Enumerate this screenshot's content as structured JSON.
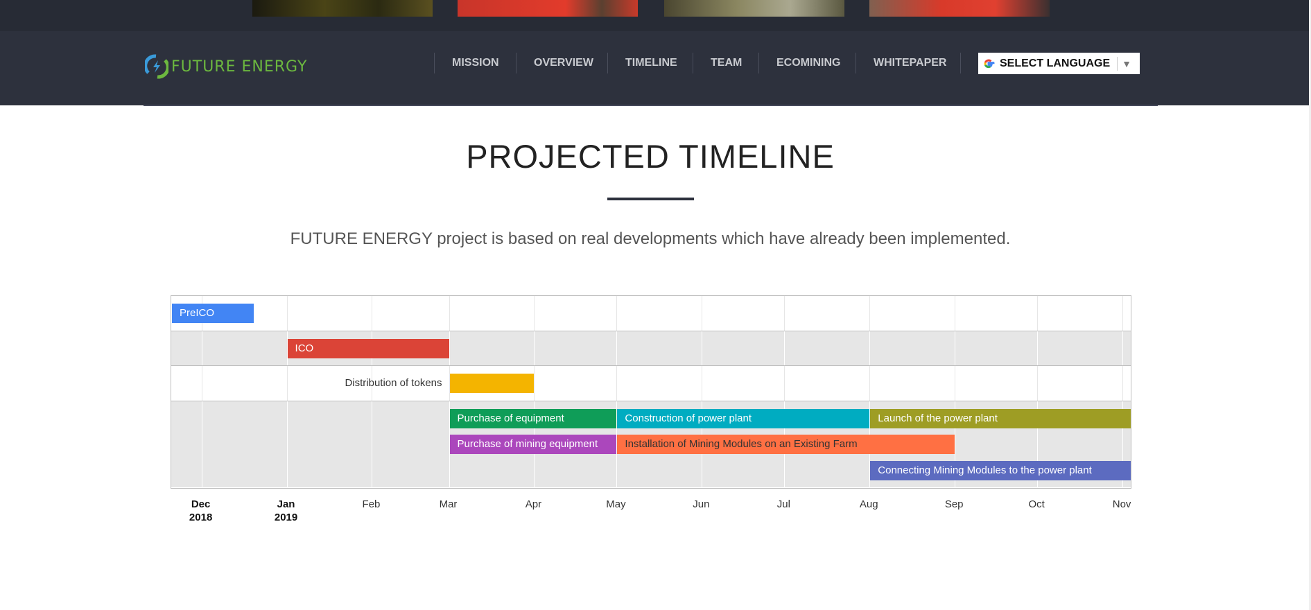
{
  "nav": {
    "logo_text": "FUTURE ENERGY",
    "items": [
      "MISSION",
      "OVERVIEW",
      "TIMELINE",
      "TEAM",
      "ECOMINING",
      "WHITEPAPER"
    ],
    "language_label": "SELECT LANGUAGE"
  },
  "main": {
    "title": "PROJECTED TIMELINE",
    "subtitle": "FUTURE ENERGY project is based on real developments which have already been implemented."
  },
  "chart_data": {
    "type": "timeline",
    "range": [
      "2018-11-20",
      "2019-11-04"
    ],
    "ticks": [
      {
        "date": "2018-12-01",
        "label": "Dec",
        "sub": "2018",
        "bold": true
      },
      {
        "date": "2019-01-01",
        "label": "Jan",
        "sub": "2019",
        "bold": true
      },
      {
        "date": "2019-02-01",
        "label": "Feb"
      },
      {
        "date": "2019-03-01",
        "label": "Mar"
      },
      {
        "date": "2019-04-01",
        "label": "Apr"
      },
      {
        "date": "2019-05-01",
        "label": "May"
      },
      {
        "date": "2019-06-01",
        "label": "Jun"
      },
      {
        "date": "2019-07-01",
        "label": "Jul"
      },
      {
        "date": "2019-08-01",
        "label": "Aug"
      },
      {
        "date": "2019-09-01",
        "label": "Sep"
      },
      {
        "date": "2019-10-01",
        "label": "Oct"
      },
      {
        "date": "2019-11-01",
        "label": "Nov"
      }
    ],
    "rows": [
      {
        "lanes": 1,
        "shaded": false
      },
      {
        "lanes": 1,
        "shaded": true
      },
      {
        "lanes": 1,
        "shaded": false
      },
      {
        "lanes": 3,
        "shaded": true
      }
    ],
    "bars": [
      {
        "label": "PreICO",
        "row": 0,
        "lane": 0,
        "start": "2018-11-20",
        "end": "2018-12-20",
        "color": "#4285f4",
        "text_color": "#ffffff"
      },
      {
        "label": "ICO",
        "row": 1,
        "lane": 0,
        "start": "2019-01-01",
        "end": "2019-03-01",
        "color": "#db4437",
        "text_color": "#ffffff"
      },
      {
        "label": "Distribution of tokens",
        "row": 2,
        "lane": 0,
        "start": "2019-03-01",
        "end": "2019-04-01",
        "color": "#f4b400",
        "text_color": "#333333",
        "outside": true
      },
      {
        "label": "Purchase of equipment",
        "row": 3,
        "lane": 0,
        "start": "2019-03-01",
        "end": "2019-05-01",
        "color": "#0f9d58",
        "text_color": "#ffffff"
      },
      {
        "label": "Construction of power plant",
        "row": 3,
        "lane": 0,
        "start": "2019-05-01",
        "end": "2019-08-01",
        "color": "#00acc1",
        "text_color": "#ffffff"
      },
      {
        "label": "Launch of the power plant",
        "row": 3,
        "lane": 0,
        "start": "2019-08-01",
        "end": "2019-11-04",
        "color": "#9e9d24",
        "text_color": "#ffffff"
      },
      {
        "label": "Purchase of mining equipment",
        "row": 3,
        "lane": 1,
        "start": "2019-03-01",
        "end": "2019-05-01",
        "color": "#ab47bc",
        "text_color": "#ffffff"
      },
      {
        "label": "Installation of Mining Modules on an Existing Farm",
        "row": 3,
        "lane": 1,
        "start": "2019-05-01",
        "end": "2019-09-01",
        "color": "#ff7043",
        "text_color": "#333333"
      },
      {
        "label": "Connecting Mining Modules to the power plant",
        "row": 3,
        "lane": 2,
        "start": "2019-08-01",
        "end": "2019-11-04",
        "color": "#5c6bc0",
        "text_color": "#ffffff"
      }
    ]
  }
}
